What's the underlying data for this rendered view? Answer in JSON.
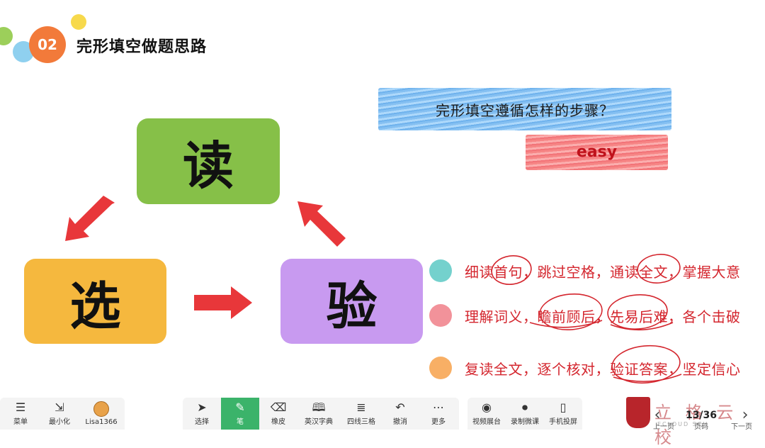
{
  "header": {
    "section_number": "02",
    "title": "完形填空做题思路"
  },
  "flow": {
    "read": "读",
    "choose": "选",
    "verify": "验"
  },
  "banner": {
    "question": "完形填空遵循怎样的步骤？",
    "level": "easy"
  },
  "steps": [
    {
      "text": "细读首句，跳过空格，通读全文，掌握大意",
      "color": "#5cc9c4"
    },
    {
      "text": "理解词义，瞻前顾后，先易后难，各个击破",
      "color": "#f07f88"
    },
    {
      "text": "复读全文，逐个核对，验证答案，坚定信心",
      "color": "#f7a14a"
    }
  ],
  "toolbar": {
    "left": [
      {
        "icon": "menu-icon",
        "label": "菜单"
      },
      {
        "icon": "minimize-icon",
        "label": "最小化"
      },
      {
        "icon": "user-avatar",
        "label": "Lisa1366"
      }
    ],
    "tools": [
      {
        "icon": "cursor-icon",
        "label": "选择"
      },
      {
        "icon": "pen-icon",
        "label": "笔"
      },
      {
        "icon": "eraser-icon",
        "label": "橡皮"
      },
      {
        "icon": "dictionary-icon",
        "label": "英汉字典"
      },
      {
        "icon": "grid-lines-icon",
        "label": "四线三格"
      },
      {
        "icon": "undo-icon",
        "label": "撤消"
      },
      {
        "icon": "more-icon",
        "label": "更多"
      }
    ],
    "media": [
      {
        "icon": "camera-icon",
        "label": "视频展台"
      },
      {
        "icon": "record-icon",
        "label": "录制微课"
      },
      {
        "icon": "phone-icon",
        "label": "手机投屏"
      }
    ],
    "active_tool": "笔",
    "accent_color": "#3bb36a"
  },
  "pager": {
    "current": "13/36",
    "prev_label": "上一页",
    "page_label": "页码",
    "next_label": "下一页"
  },
  "branding": {
    "school_name": "立 格 云 校",
    "school_sub": "ECLOUD SCH"
  }
}
